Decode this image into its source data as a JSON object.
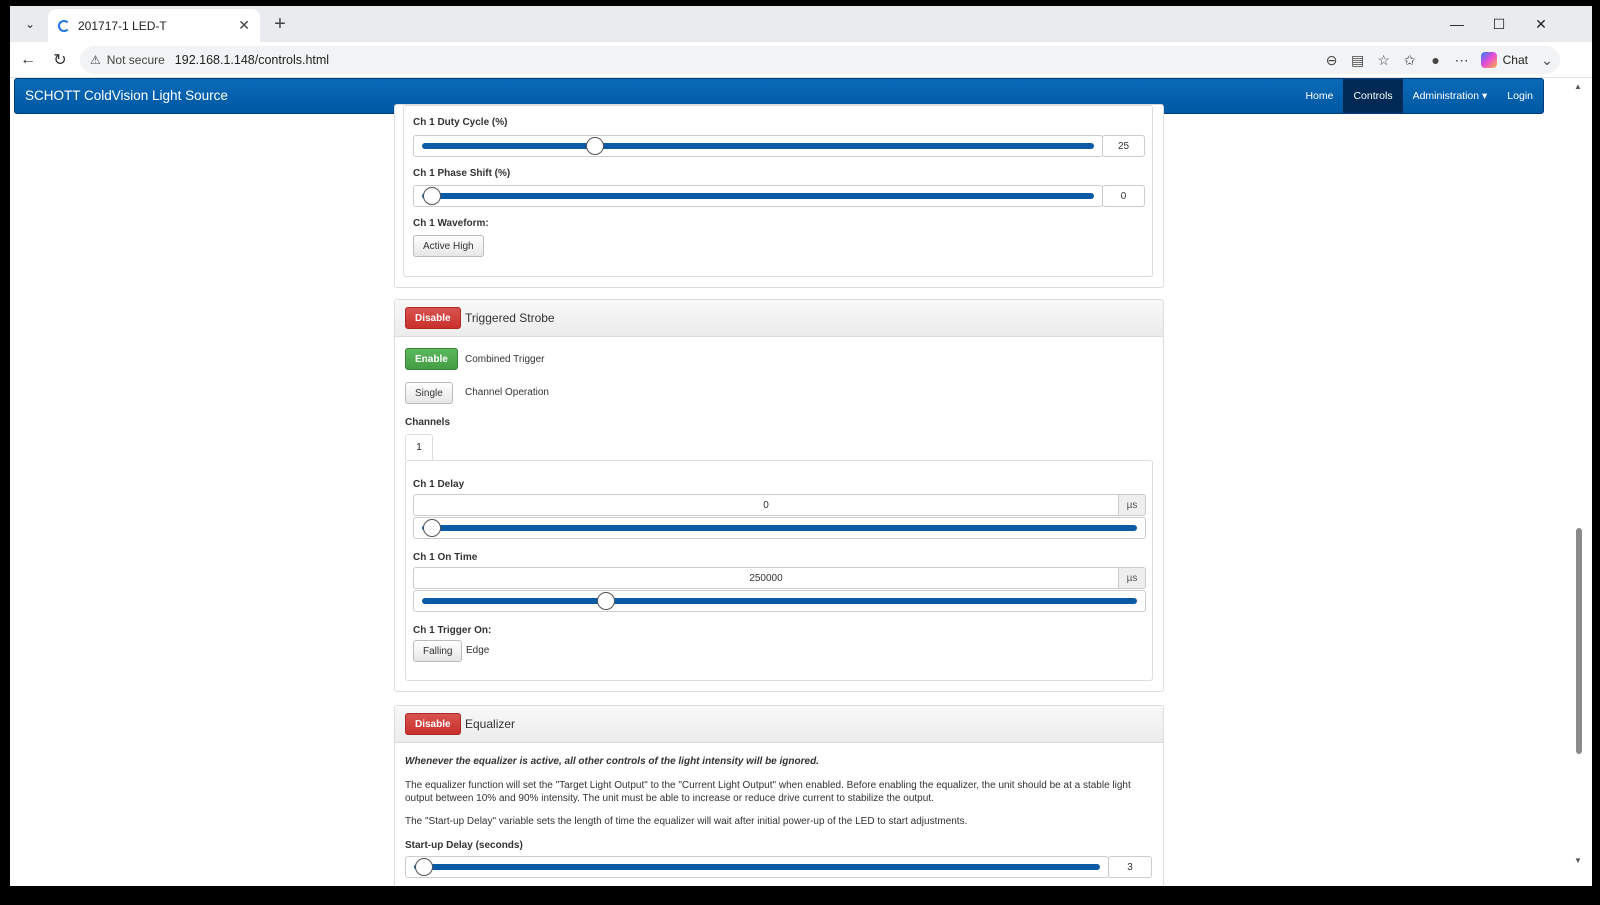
{
  "browser": {
    "tab_title": "201717-1 LED-T",
    "security_label": "Not secure",
    "url": "192.168.1.148/controls.html",
    "chat_label": "Chat"
  },
  "site": {
    "brand": "SCHOTT ColdVision Light Source",
    "nav": {
      "home": "Home",
      "controls": "Controls",
      "administration": "Administration ▾",
      "login": "Login"
    }
  },
  "pwm": {
    "duty_label": "Ch 1 Duty Cycle (%)",
    "duty_value": "25",
    "duty_level": 0.25,
    "phase_label": "Ch 1 Phase Shift (%)",
    "phase_value": "0",
    "phase_level": 0,
    "waveform_label": "Ch 1 Waveform:",
    "waveform_button": "Active High"
  },
  "strobe": {
    "toggle_button": "Disable",
    "title": "Triggered Strobe",
    "combined_button": "Enable",
    "combined_label": "Combined Trigger",
    "channel_mode_button": "Single",
    "channel_mode_label": "Channel Operation",
    "channels_label": "Channels",
    "channel_tab": "1",
    "delay_label": "Ch 1 Delay",
    "delay_value": "0",
    "delay_unit": "µs",
    "delay_level": 0,
    "ontime_label": "Ch 1 On Time",
    "ontime_value": "250000",
    "ontime_unit": "µs",
    "ontime_level": 0.25,
    "trigger_label": "Ch 1 Trigger On:",
    "trigger_button": "Falling",
    "trigger_suffix": "Edge"
  },
  "equalizer": {
    "toggle_button": "Disable",
    "title": "Equalizer",
    "warning": "Whenever the equalizer is active, all other controls of the light intensity will be ignored.",
    "para1": "The equalizer function will set the \"Target Light Output\" to the \"Current Light Output\" when enabled. Before enabling the equalizer, the unit should be at a stable light output between 10% and 90% intensity. The unit must be able to increase or reduce drive current to stabilize the output.",
    "para2": "The \"Start-up Delay\" variable sets the length of time the equalizer will wait after initial power-up of the LED to start adjustments.",
    "startup_label": "Start-up Delay (seconds)",
    "startup_value": "3",
    "startup_level": 0
  }
}
